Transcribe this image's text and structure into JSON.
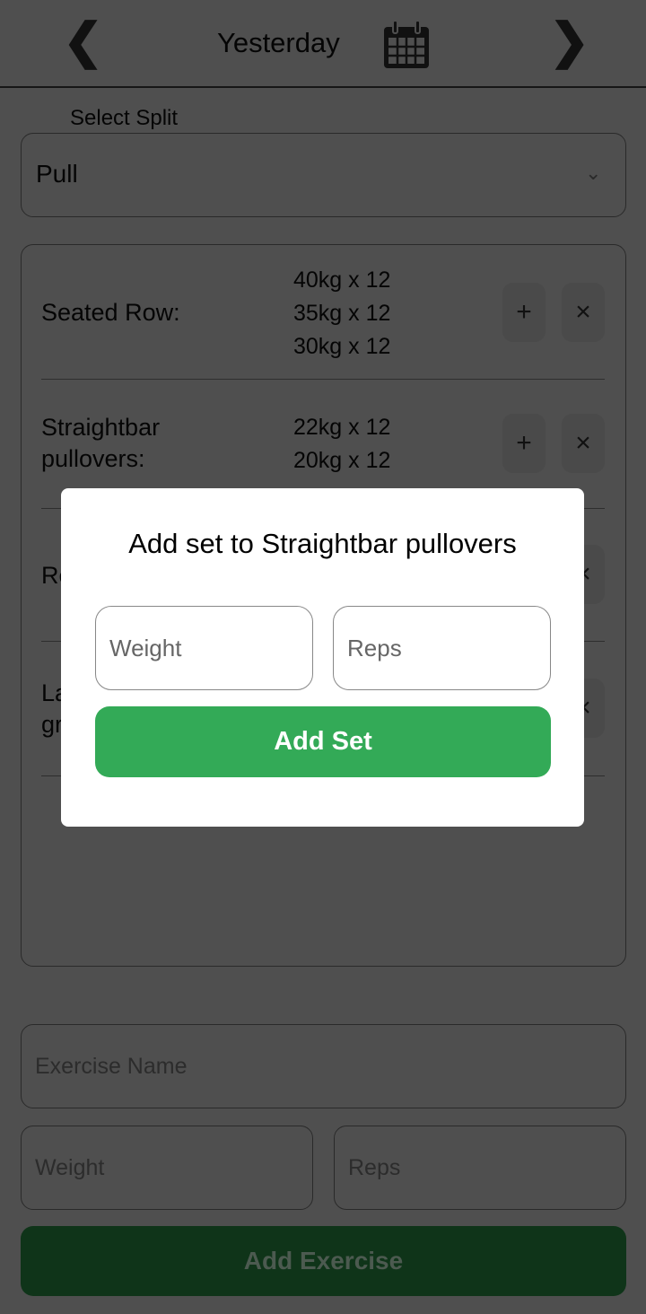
{
  "header": {
    "title": "Yesterday",
    "prev_icon": "chevron-left-icon",
    "next_icon": "chevron-right-icon",
    "calendar_icon": "calendar-icon"
  },
  "split": {
    "label": "Select Split",
    "value": "Pull"
  },
  "exercises": [
    {
      "name": "Seated Row:",
      "sets": [
        "40kg x 12",
        "35kg x 12",
        "30kg x 12"
      ]
    },
    {
      "name_lines": [
        "Straightbar",
        "pullovers:"
      ],
      "sets": [
        "22kg x 12",
        "20kg x 12"
      ]
    },
    {
      "name": "Re"
    },
    {
      "name_lines": [
        "La",
        "gr"
      ]
    }
  ],
  "form": {
    "exercise_placeholder": "Exercise Name",
    "weight_placeholder": "Weight",
    "reps_placeholder": "Reps",
    "add_label": "Add Exercise"
  },
  "modal": {
    "title": "Add set to Straightbar pullovers",
    "weight_placeholder": "Weight",
    "reps_placeholder": "Reps",
    "add_label": "Add Set"
  },
  "colors": {
    "accent": "#33aa57"
  }
}
